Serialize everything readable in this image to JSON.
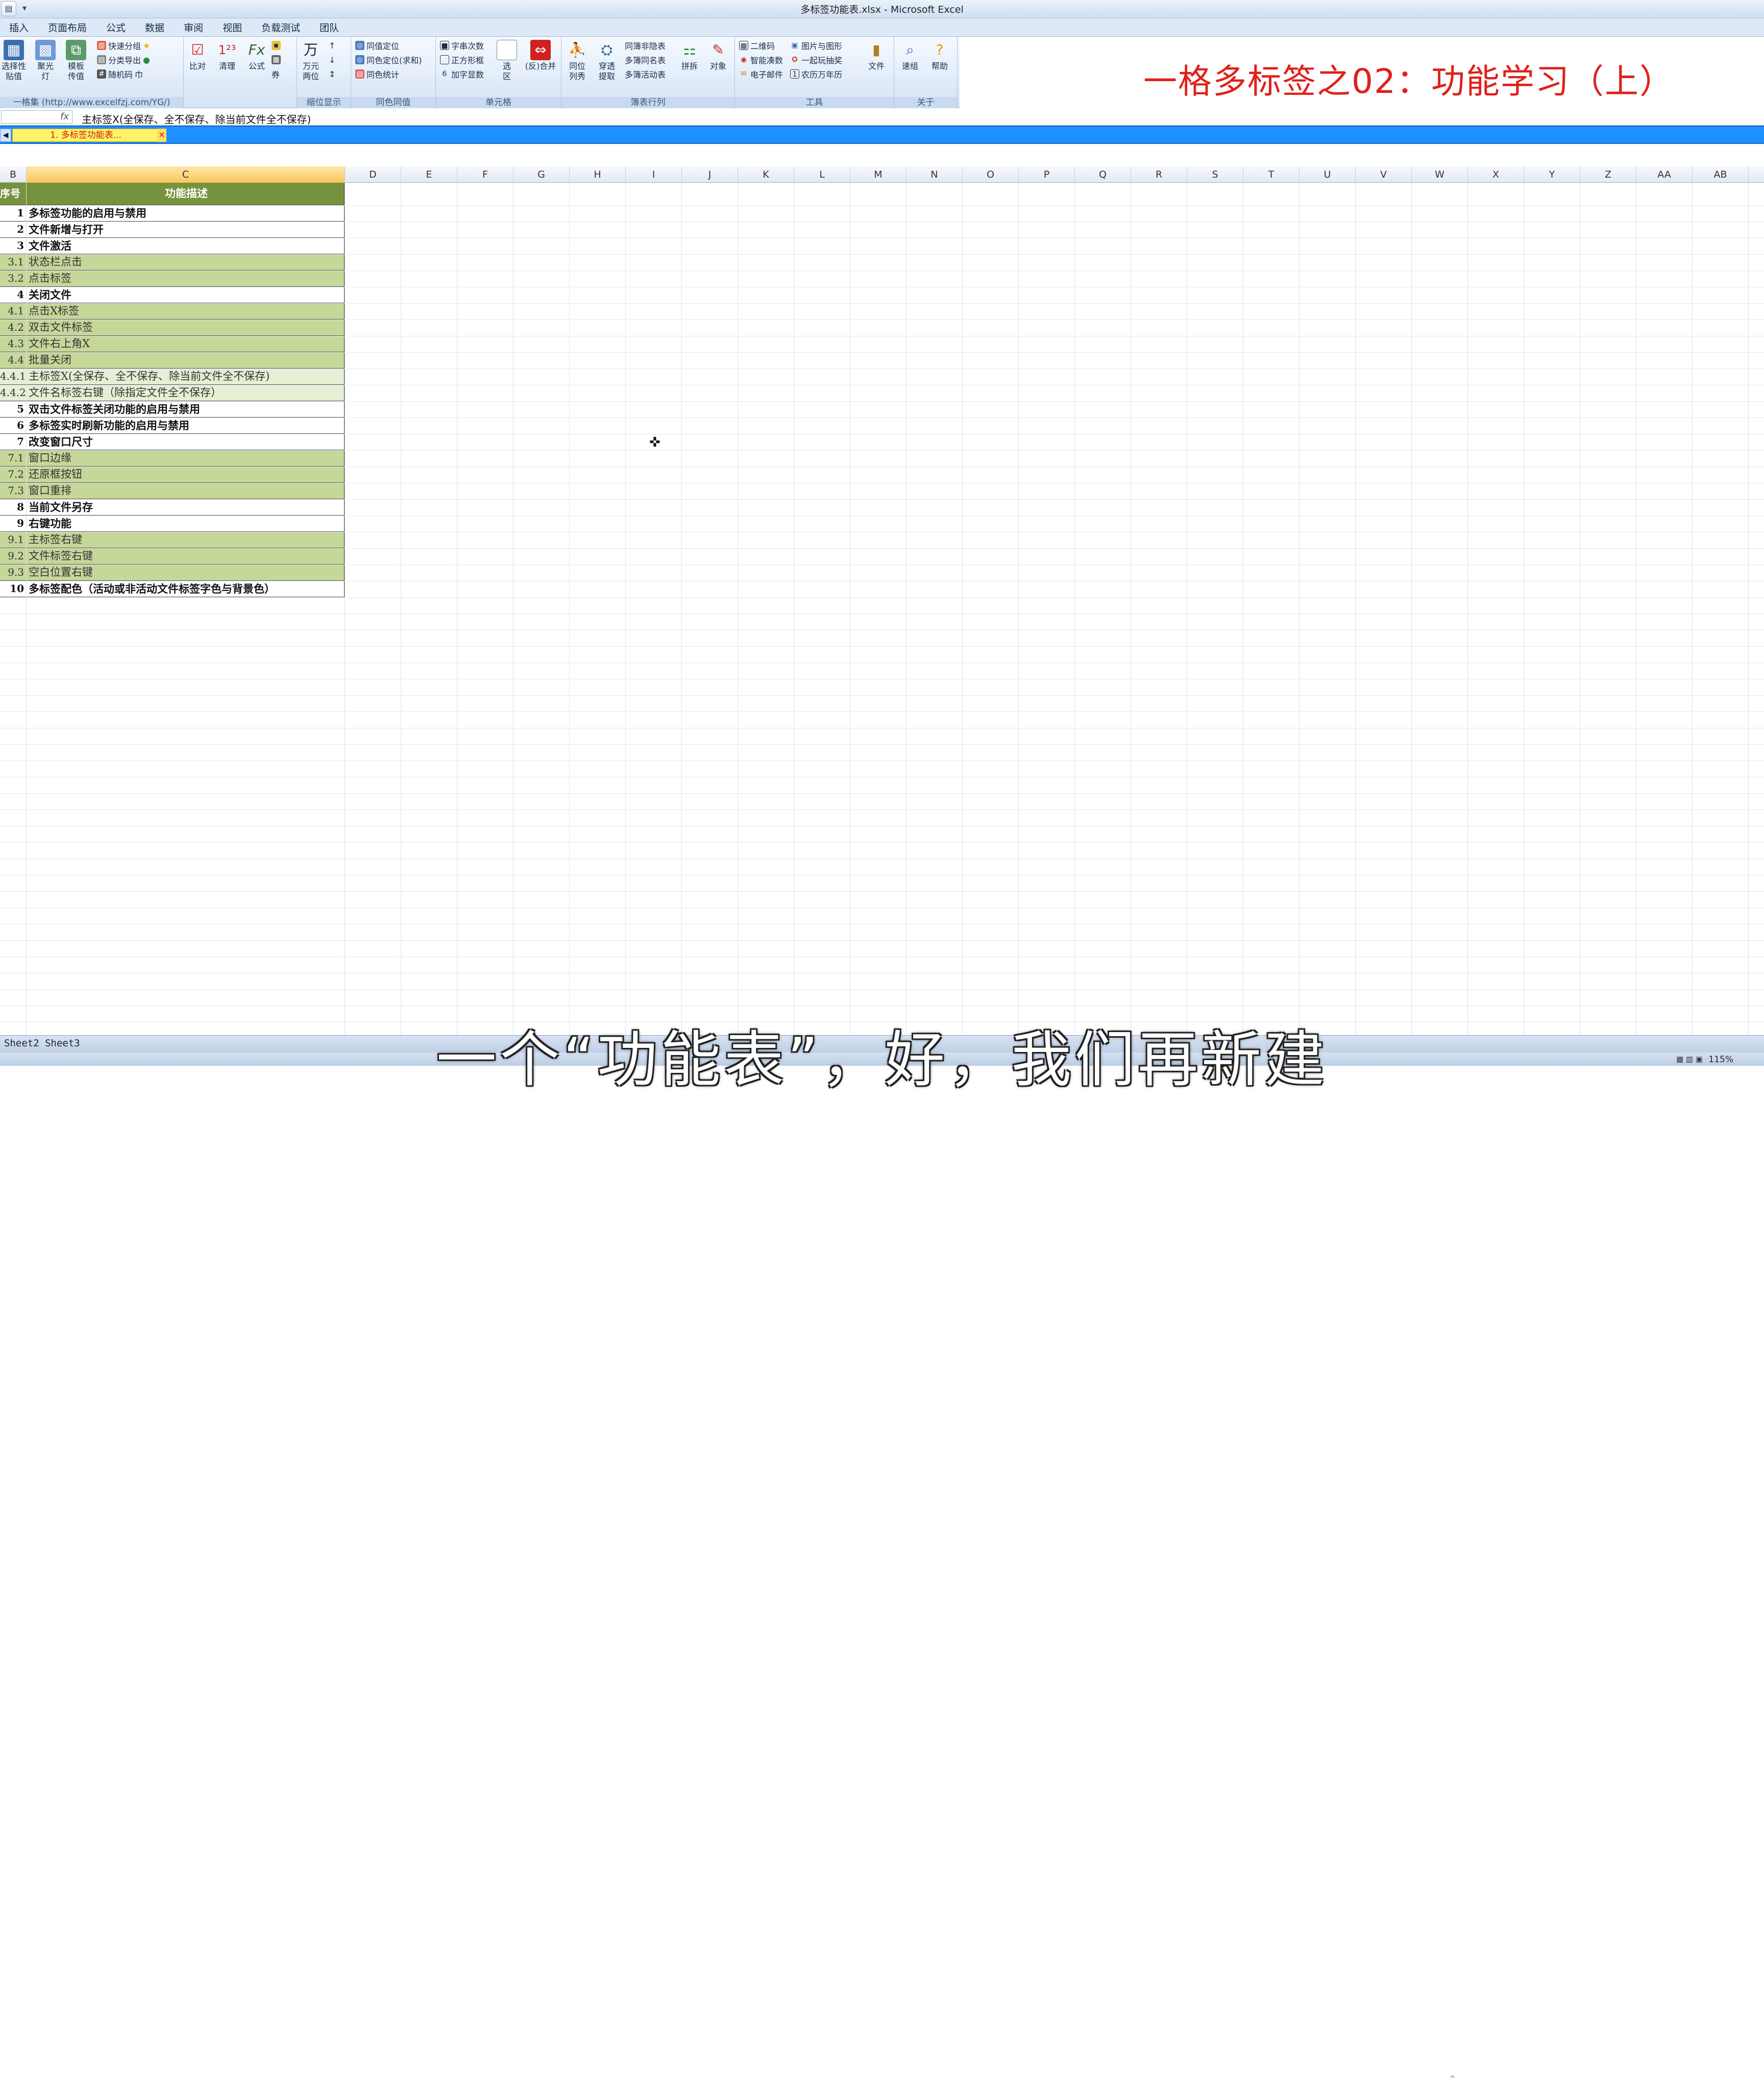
{
  "window": {
    "title": "多标签功能表.xlsx - Microsoft Excel"
  },
  "qat": {
    "open_icon": "folder-open-icon",
    "dropdown": "▾"
  },
  "menu": [
    "插入",
    "页面布局",
    "公式",
    "数据",
    "审阅",
    "视图",
    "负载测试",
    "团队"
  ],
  "ribbon": {
    "groups": [
      {
        "label": "一格集 (http://www.excelfzj.com/YG/)",
        "big": [
          "选择性\n贴值",
          "聚光\n灯",
          "模板\n传值"
        ],
        "small": [
          "快速分组",
          "分类导出",
          "随机码"
        ]
      },
      {
        "label": "",
        "big": [
          "比对",
          "清理",
          "公式"
        ],
        "small": []
      },
      {
        "label": "缩位显示",
        "big": [
          "万元\n两位"
        ],
        "small": []
      },
      {
        "label": "同色同值",
        "big": [],
        "small": [
          "同值定位",
          "同色定位(求和)",
          "同色统计"
        ]
      },
      {
        "label": "单元格",
        "big": [
          "选\n区",
          "(反)合并"
        ],
        "small": [
          "字串次数",
          "正方形框",
          "加字显数"
        ]
      },
      {
        "label": "簿表行列",
        "big": [
          "同位\n列秀",
          "穿透\n提取",
          "拼拆",
          "对象"
        ],
        "small": [
          "同簿非隐表",
          "多簿同名表",
          "多簿活动表"
        ]
      },
      {
        "label": "工具",
        "big": [
          "文件"
        ],
        "small": [
          "二维码",
          "智能凑数",
          "电子邮件",
          "图片与图形",
          "一起玩抽奖",
          "农历万年历"
        ]
      },
      {
        "label": "关于",
        "big": [
          "速组",
          "帮助"
        ],
        "small": []
      }
    ]
  },
  "formula_bar": {
    "fx": "fx",
    "content": "主标签X(全保存、全不保存、除当前文件全不保存)"
  },
  "file_tab": {
    "label": "1. 多标签功能表...",
    "close": "×"
  },
  "columns": [
    "B",
    "C",
    "D",
    "E",
    "F",
    "G",
    "H",
    "I",
    "J",
    "K",
    "L",
    "M",
    "N",
    "O",
    "P",
    "Q",
    "R",
    "S",
    "T",
    "U",
    "V",
    "W",
    "X",
    "Y",
    "Z",
    "AA",
    "AB"
  ],
  "table": {
    "header": {
      "num": "序号",
      "desc": "功能描述"
    },
    "rows": [
      {
        "num": "1",
        "desc": "多标签功能的启用与禁用",
        "level": "main"
      },
      {
        "num": "2",
        "desc": "文件新增与打开",
        "level": "main"
      },
      {
        "num": "3",
        "desc": "文件激活",
        "level": "main"
      },
      {
        "num": "3.1",
        "desc": "状态栏点击",
        "level": "sub"
      },
      {
        "num": "3.2",
        "desc": "点击标签",
        "level": "sub"
      },
      {
        "num": "4",
        "desc": "关闭文件",
        "level": "main"
      },
      {
        "num": "4.1",
        "desc": "点击X标签",
        "level": "sub"
      },
      {
        "num": "4.2",
        "desc": "双击文件标签",
        "level": "sub"
      },
      {
        "num": "4.3",
        "desc": "文件右上角X",
        "level": "sub"
      },
      {
        "num": "4.4",
        "desc": "批量关闭",
        "level": "sub"
      },
      {
        "num": "4.4.1",
        "desc": "主标签X(全保存、全不保存、除当前文件全不保存)",
        "level": "subsub"
      },
      {
        "num": "4.4.2",
        "desc": "文件名标签右键（除指定文件全不保存）",
        "level": "subsub"
      },
      {
        "num": "5",
        "desc": "双击文件标签关闭功能的启用与禁用",
        "level": "main"
      },
      {
        "num": "6",
        "desc": "多标签实时刷新功能的启用与禁用",
        "level": "main"
      },
      {
        "num": "7",
        "desc": "改变窗口尺寸",
        "level": "main"
      },
      {
        "num": "7.1",
        "desc": "窗口边缘",
        "level": "sub"
      },
      {
        "num": "7.2",
        "desc": "还原框按钮",
        "level": "sub"
      },
      {
        "num": "7.3",
        "desc": "窗口重排",
        "level": "sub"
      },
      {
        "num": "8",
        "desc": "当前文件另存",
        "level": "main"
      },
      {
        "num": "9",
        "desc": "右键功能",
        "level": "main"
      },
      {
        "num": "9.1",
        "desc": "主标签右键",
        "level": "sub"
      },
      {
        "num": "9.2",
        "desc": "文件标签右键",
        "level": "sub"
      },
      {
        "num": "9.3",
        "desc": "空白位置右键",
        "level": "sub"
      },
      {
        "num": "10",
        "desc": "多标签配色（活动或非活动文件标签字色与背景色）",
        "level": "main"
      }
    ]
  },
  "sheet_tabs": "Sheet2  Sheet3",
  "status": {
    "zoom": "115%"
  },
  "overlay": {
    "title": "一格多标签之02：功能学习（上）",
    "subtitle": "一个“功能表”，好，我们再新建"
  },
  "colors": {
    "header_green": "#76923c",
    "sub_green": "#c6d79a",
    "subsub_green": "#e6eed3",
    "tab_blue": "#1e90ff",
    "file_tab_yellow": "#fff36a",
    "overlay_red": "#e0201a"
  }
}
